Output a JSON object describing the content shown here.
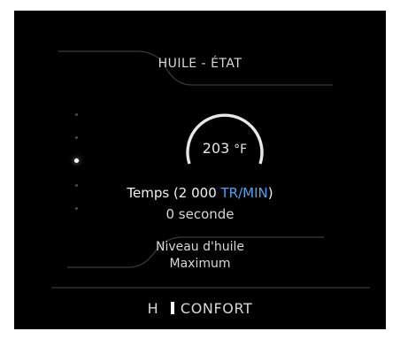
{
  "oil_status": {
    "header": "HUILE - ÉTAT",
    "gauge": {
      "value": "203",
      "unit": "°F"
    },
    "time": {
      "label_prefix": "Temps (2 000 ",
      "rpm": "TR/MIN",
      "label_suffix": ")",
      "value": "0 seconde"
    },
    "level": {
      "label": "Niveau d'huile",
      "value": "Maximum"
    }
  },
  "pager": {
    "total": 5,
    "active_index": 2
  },
  "footer": {
    "gear": "H",
    "mode": "CONFORT"
  },
  "colors": {
    "background": "#000000",
    "text": "#e6e6e6",
    "accent_blue": "#5aa0e6",
    "line": "#3c3c3c"
  }
}
